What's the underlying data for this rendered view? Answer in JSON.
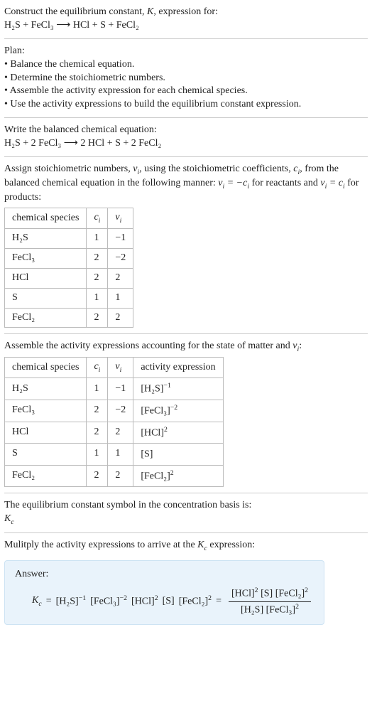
{
  "prompt": {
    "line1_a": "Construct the equilibrium constant, ",
    "line1_b": ", expression for:",
    "eq_unbalanced": "H₂S + FeCl₃  ⟶  HCl + S + FeCl₂"
  },
  "plan": {
    "heading": "Plan:",
    "b1": "• Balance the chemical equation.",
    "b2": "• Determine the stoichiometric numbers.",
    "b3": "• Assemble the activity expression for each chemical species.",
    "b4": "• Use the activity expressions to build the equilibrium constant expression."
  },
  "balanced": {
    "heading": "Write the balanced chemical equation:",
    "eq": "H₂S + 2 FeCl₃  ⟶  2 HCl + S + 2 FeCl₂"
  },
  "stoich_text": {
    "a": "Assign stoichiometric numbers, ",
    "b": ", using the stoichiometric coefficients, ",
    "c": ", from the balanced chemical equation in the following manner: ",
    "d": " for reactants and ",
    "e": " for products:"
  },
  "table1": {
    "h1": "chemical species",
    "h2": "cᵢ",
    "h3": "νᵢ",
    "rows": [
      {
        "sp": "H₂S",
        "c": "1",
        "v": "−1"
      },
      {
        "sp": "FeCl₃",
        "c": "2",
        "v": "−2"
      },
      {
        "sp": "HCl",
        "c": "2",
        "v": "2"
      },
      {
        "sp": "S",
        "c": "1",
        "v": "1"
      },
      {
        "sp": "FeCl₂",
        "c": "2",
        "v": "2"
      }
    ]
  },
  "activity_text": {
    "a": "Assemble the activity expressions accounting for the state of matter and ",
    "b": ":"
  },
  "table2": {
    "h1": "chemical species",
    "h2": "cᵢ",
    "h3": "νᵢ",
    "h4": "activity expression",
    "rows": [
      {
        "sp": "H₂S",
        "c": "1",
        "v": "−1",
        "ae_base": "[H₂S]",
        "ae_exp": "−1"
      },
      {
        "sp": "FeCl₃",
        "c": "2",
        "v": "−2",
        "ae_base": "[FeCl₃]",
        "ae_exp": "−2"
      },
      {
        "sp": "HCl",
        "c": "2",
        "v": "2",
        "ae_base": "[HCl]",
        "ae_exp": "2"
      },
      {
        "sp": "S",
        "c": "1",
        "v": "1",
        "ae_base": "[S]",
        "ae_exp": ""
      },
      {
        "sp": "FeCl₂",
        "c": "2",
        "v": "2",
        "ae_base": "[FeCl₂]",
        "ae_exp": "2"
      }
    ]
  },
  "symbol": {
    "line": "The equilibrium constant symbol in the concentration basis is:",
    "kc": "K꜀"
  },
  "multiply": {
    "a": "Mulitply the activity expressions to arrive at the ",
    "b": " expression:"
  },
  "answer": {
    "label": "Answer:",
    "kc": "K꜀",
    "eq": "=",
    "t1": "[H₂S]",
    "e1": "−1",
    "t2": "[FeCl₃]",
    "e2": "−2",
    "t3": "[HCl]",
    "e3": "2",
    "t4": "[S]",
    "t5": "[FeCl₂]",
    "e5": "2",
    "num1": "[HCl]",
    "ne1": "2",
    "num2": "[S]",
    "num3": "[FeCl₂]",
    "ne3": "2",
    "den1": "[H₂S]",
    "den2": "[FeCl₃]",
    "de2": "2"
  }
}
